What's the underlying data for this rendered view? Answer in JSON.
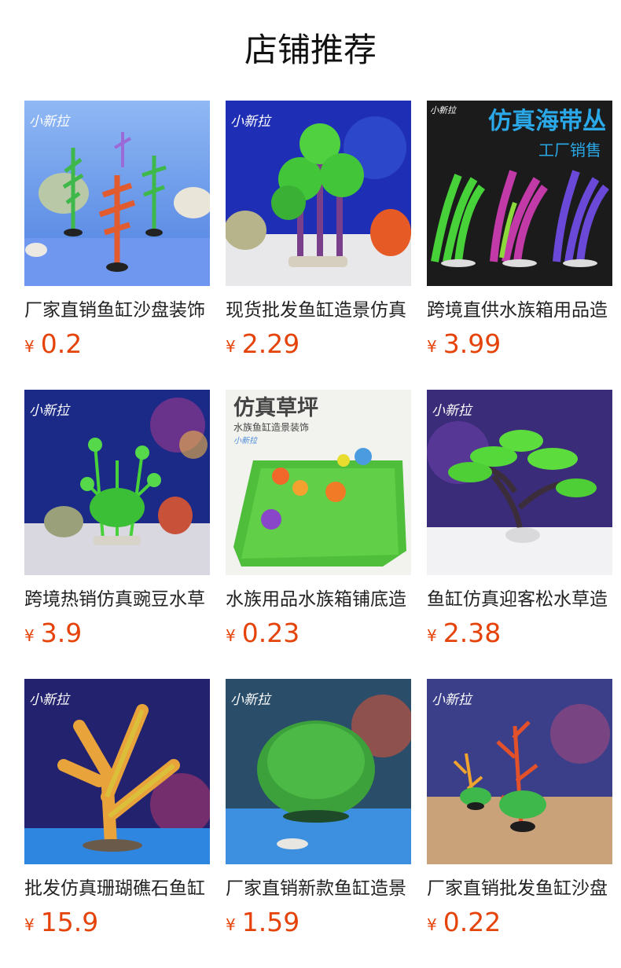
{
  "section_title": "店铺推荐",
  "currency": "¥",
  "products": [
    {
      "name": "厂家直销鱼缸沙盘装饰",
      "price": "0.2",
      "image": {
        "watermark": "小新拉"
      }
    },
    {
      "name": "现货批发鱼缸造景仿真",
      "price": "2.29",
      "image": {
        "watermark": "小新拉"
      }
    },
    {
      "name": "跨境直供水族箱用品造",
      "price": "3.99",
      "image": {
        "watermark": "小新拉",
        "headline": "仿真海带丛",
        "subline": "工厂销售"
      }
    },
    {
      "name": "跨境热销仿真豌豆水草",
      "price": "3.9",
      "image": {
        "watermark": "小新拉"
      }
    },
    {
      "name": "水族用品水族箱铺底造",
      "price": "0.23",
      "image": {
        "watermark": "小新拉",
        "headline": "仿真草坪",
        "subline": "水族鱼缸造景装饰"
      }
    },
    {
      "name": "鱼缸仿真迎客松水草造",
      "price": "2.38",
      "image": {
        "watermark": "小新拉"
      }
    },
    {
      "name": "批发仿真珊瑚礁石鱼缸",
      "price": "15.9",
      "image": {
        "watermark": "小新拉"
      }
    },
    {
      "name": "厂家直销新款鱼缸造景",
      "price": "1.59",
      "image": {
        "watermark": "小新拉"
      }
    },
    {
      "name": "厂家直销批发鱼缸沙盘",
      "price": "0.22",
      "image": {
        "watermark": "小新拉"
      }
    }
  ]
}
